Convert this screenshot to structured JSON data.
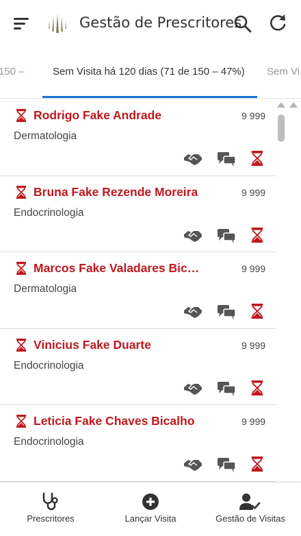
{
  "header": {
    "title": "Gestão de Prescritores",
    "menu_icon": "menu-icon",
    "logo_icon": "logo-icon",
    "search_icon": "search-icon",
    "refresh_icon": "refresh-icon"
  },
  "tabs": [
    {
      "label": "150 –",
      "active": false
    },
    {
      "label": "Sem Visita há 120 dias (71 de 150 – 47%)",
      "active": true
    },
    {
      "label": "Sem Vi",
      "active": false
    }
  ],
  "prescribers": [
    {
      "name": "Rodrigo Fake Andrade",
      "code": "9 999",
      "specialty": "Dermatologia"
    },
    {
      "name": "Bruna Fake Rezende Moreira",
      "code": "9 999",
      "specialty": "Endocrinologia"
    },
    {
      "name": "Marcos Fake Valadares Bical...",
      "code": "9 999",
      "specialty": "Dermatologia"
    },
    {
      "name": "Vinicius Fake Duarte",
      "code": "9 999",
      "specialty": "Endocrinologia"
    },
    {
      "name": "Leticia Fake Chaves Bicalho",
      "code": "9 999",
      "specialty": "Endocrinologia"
    }
  ],
  "bottom_nav": [
    {
      "label": "Prescritores",
      "icon": "stethoscope-icon"
    },
    {
      "label": "Lançar Visita",
      "icon": "plus-circle-icon"
    },
    {
      "label": "Gestão de Visitas",
      "icon": "user-check-icon"
    }
  ],
  "colors": {
    "accent": "#c0181e",
    "tab_indicator": "#1976d2",
    "icon_gray": "#555555"
  }
}
